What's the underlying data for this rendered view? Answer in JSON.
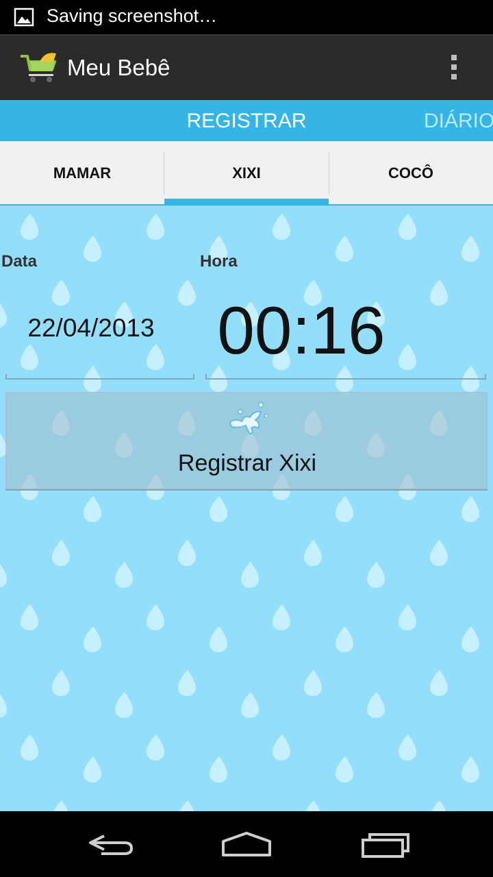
{
  "status_bar": {
    "text": "Saving screenshot…"
  },
  "action_bar": {
    "title": "Meu Bebê"
  },
  "pager": {
    "active": "REGISTRAR",
    "next": "DIÁRIO"
  },
  "tabs": [
    {
      "label": "MAMAR"
    },
    {
      "label": "XIXI"
    },
    {
      "label": "COCÔ"
    }
  ],
  "form": {
    "date_label": "Data",
    "date_value": "22/04/2013",
    "time_label": "Hora",
    "time_value": "00:16",
    "button_label": "Registrar Xixi"
  },
  "colors": {
    "accent": "#35b5e5",
    "background": "#93dffb",
    "drop": "#c6efff",
    "action_bar": "#2b2b2b"
  }
}
